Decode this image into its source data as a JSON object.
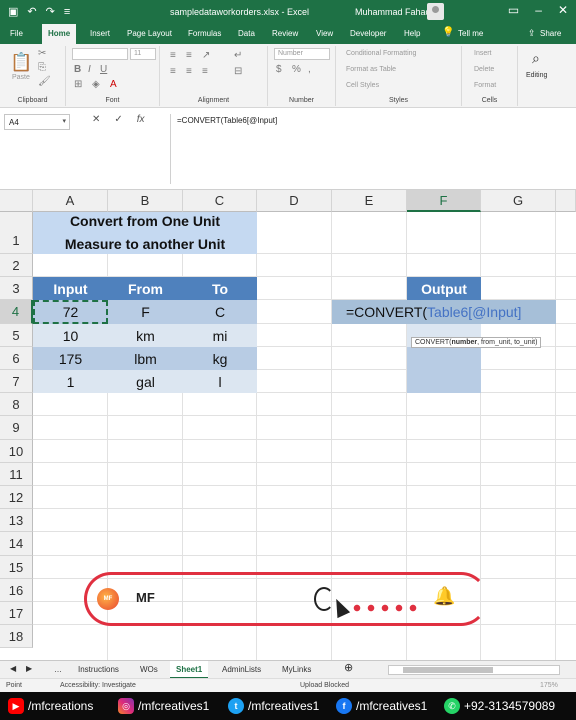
{
  "titlebar": {
    "doc_title": "sampledataworkorders.xlsx  -  Excel",
    "user_name": "Muhammad Fahad",
    "icons": [
      "save-icon",
      "undo-icon",
      "redo-icon",
      "customize-icon"
    ]
  },
  "ribbon_tabs": [
    "File",
    "Home",
    "Insert",
    "Page Layout",
    "Formulas",
    "Data",
    "Review",
    "Developer",
    "Help",
    "Tell me",
    "Share"
  ],
  "ribbon": {
    "clipboard": {
      "label": "Clipboard",
      "paste": "Paste"
    },
    "font": {
      "label": "Font",
      "font_size": "11"
    },
    "alignment": {
      "label": "Alignment"
    },
    "number": {
      "label": "Number",
      "format": "Number"
    },
    "styles": {
      "label": "Styles",
      "conditional": "Conditional Formatting",
      "format_table": "Format as Table",
      "cell_styles": "Cell Styles"
    },
    "cells": {
      "label": "Cells",
      "insert": "Insert",
      "delete": "Delete",
      "format": "Format"
    },
    "editing": {
      "label": "Editing"
    }
  },
  "formula_bar": {
    "name_box": "A4",
    "formula": "=CONVERT(Table6[@Input]"
  },
  "columns": [
    "A",
    "B",
    "C",
    "D",
    "E",
    "F",
    "G"
  ],
  "rows": [
    "1",
    "2",
    "3",
    "4",
    "5",
    "6",
    "7",
    "8",
    "9",
    "10",
    "11",
    "12",
    "13",
    "14",
    "15",
    "16",
    "17",
    "18"
  ],
  "table": {
    "title_line1": "Convert from One Unit",
    "title_line2": "Measure to another Unit",
    "headers": [
      "Input",
      "From",
      "To"
    ],
    "output_header": "Output",
    "data": [
      [
        "72",
        "F",
        "C"
      ],
      [
        "10",
        "km",
        "mi"
      ],
      [
        "175",
        "lbm",
        "kg"
      ],
      [
        "1",
        "gal",
        "l"
      ]
    ]
  },
  "editing_cell": {
    "prefix": "=CONVERT(",
    "ref": "Table6[@Input]",
    "tooltip_fn": "CONVERT(",
    "tooltip_arg_bold": "number",
    "tooltip_rest": ", from_unit, to_unit)"
  },
  "overlay": {
    "brand": "MF",
    "logo_text": "MF"
  },
  "sheet_tabs": [
    "Instructions",
    "WOs",
    "Sheet1",
    "AdminLists",
    "MyLinks"
  ],
  "active_sheet": "Sheet1",
  "statusbar": {
    "mode": "Point",
    "accessibility": "Accessibility: Investigate",
    "upload": "Upload Blocked",
    "zoom": "175%"
  },
  "social": {
    "youtube": "/mfcreations",
    "instagram": "/mfcreatives1",
    "twitter": "/mfcreatives1",
    "facebook": "/mfcreatives1",
    "whatsapp": "+92-3134579089"
  },
  "colors": {
    "excel_green": "#1e7145",
    "table_header": "#4f81bd",
    "band_dark": "#b8cce4",
    "band_light": "#dce6f1",
    "title_fill": "#c5d9f1"
  }
}
